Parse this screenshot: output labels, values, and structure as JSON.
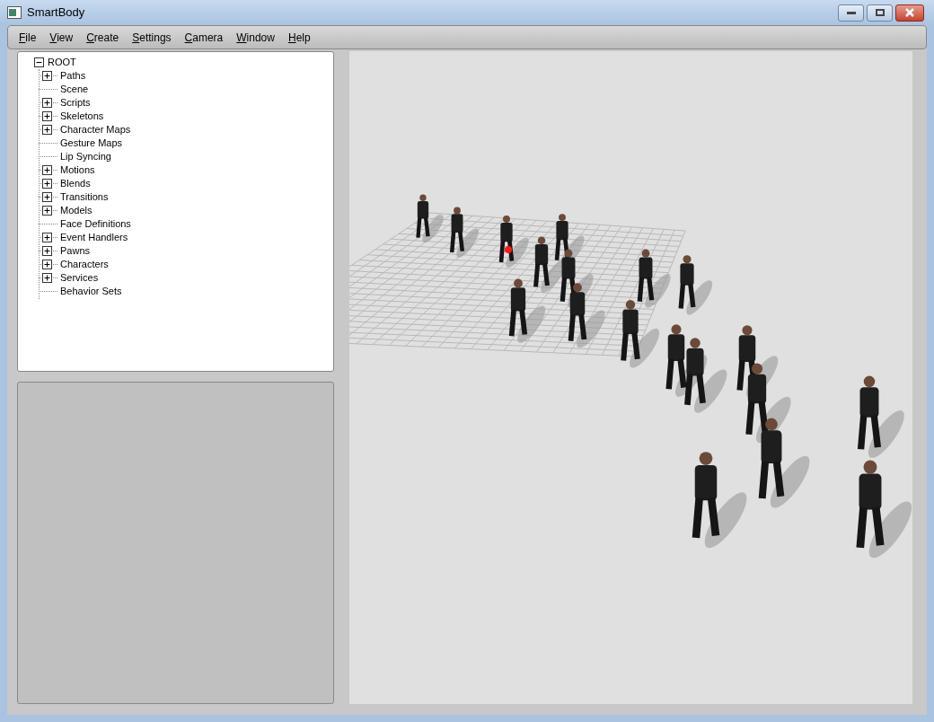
{
  "window": {
    "title": "SmartBody"
  },
  "menu": [
    "File",
    "View",
    "Create",
    "Settings",
    "Camera",
    "Window",
    "Help"
  ],
  "tree": {
    "label": "ROOT",
    "expanded": true,
    "children": [
      {
        "label": "Paths",
        "expandable": true
      },
      {
        "label": "Scene",
        "expandable": false
      },
      {
        "label": "Scripts",
        "expandable": true
      },
      {
        "label": "Skeletons",
        "expandable": true
      },
      {
        "label": "Character Maps",
        "expandable": true
      },
      {
        "label": "Gesture Maps",
        "expandable": false
      },
      {
        "label": "Lip Syncing",
        "expandable": false
      },
      {
        "label": "Motions",
        "expandable": true
      },
      {
        "label": "Blends",
        "expandable": true
      },
      {
        "label": "Transitions",
        "expandable": true
      },
      {
        "label": "Models",
        "expandable": true
      },
      {
        "label": "Face Definitions",
        "expandable": false
      },
      {
        "label": "Event Handlers",
        "expandable": true
      },
      {
        "label": "Pawns",
        "expandable": true
      },
      {
        "label": "Characters",
        "expandable": true
      },
      {
        "label": "Services",
        "expandable": true
      },
      {
        "label": "Behavior Sets",
        "expandable": false
      }
    ]
  }
}
